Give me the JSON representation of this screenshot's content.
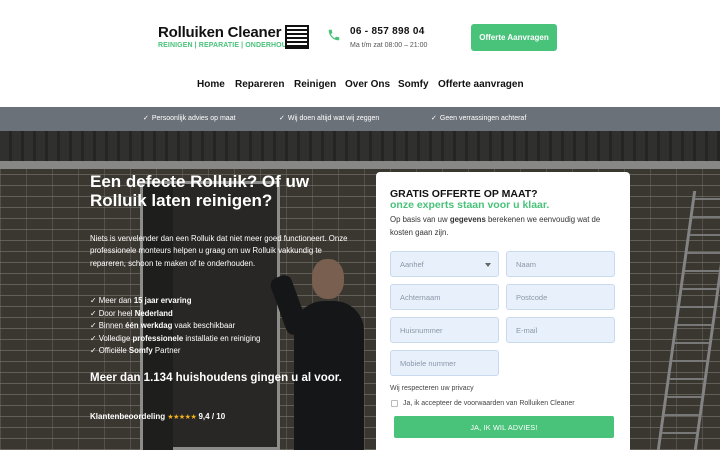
{
  "header": {
    "logo_title": "Rolluiken Cleaner",
    "logo_subtitle": "REINIGEN | REPARATIE | ONDERHOUD",
    "phone_number": "06 - 857 898 04",
    "phone_hours": "Ma t/m zat 08:00 – 21:00",
    "cta_label": "Offerte Aanvragen"
  },
  "nav": {
    "items": [
      "Home",
      "Repareren",
      "Reinigen",
      "Over Ons",
      "Somfy",
      "Offerte aanvragen"
    ]
  },
  "usp": {
    "items": [
      "Persoonlijk advies op maat",
      "Wij doen altijd wat wij zeggen",
      "Geen verrassingen achteraf"
    ]
  },
  "hero": {
    "title": "Een defecte Rolluik? Of uw Rolluik laten reinigen?",
    "intro": "Niets is vervelender dan een Rolluik dat niet meer goed functioneert. Onze professionele monteurs helpen u graag om uw Rolluik vakkundig te repareren, schoon te maken of te onderhouden.",
    "bullets": [
      {
        "pre": "Meer dan ",
        "bold": "15 jaar ervaring",
        "post": ""
      },
      {
        "pre": "Door heel ",
        "bold": "Nederland",
        "post": ""
      },
      {
        "pre": "Binnen ",
        "bold": "één werkdag",
        "post": " vaak beschikbaar"
      },
      {
        "pre": "Volledige ",
        "bold": "professionele",
        "post": " installatie en reiniging"
      },
      {
        "pre": "Officiële ",
        "bold": "Somfy",
        "post": " Partner"
      }
    ],
    "households": "Meer dan 1.134 huishoudens gingen u al voor.",
    "rating_label": "Klantenbeoordeling",
    "rating_stars": "★★★★★",
    "rating_score": "9,4 / 10"
  },
  "form": {
    "title": "GRATIS OFFERTE OP MAAT?",
    "subtitle": "onze experts staan voor u klaar.",
    "intro_pre": "Op basis van uw ",
    "intro_bold": "gegevens",
    "intro_post": " berekenen we eenvoudig wat de kosten gaan zijn.",
    "fields": {
      "aanhef": "Aanhef",
      "naam": "Naam",
      "achternaam": "Achternaam",
      "postcode": "Postcode",
      "huisnummer": "Huisnummer",
      "email": "E-mail",
      "mobiel": "Mobiele nummer"
    },
    "privacy": "Wij respecteren uw privacy",
    "consent": "Ja, ik accepteer de voorwaarden van Rolluiken Cleaner",
    "submit": "JA, IK WIL ADVIES!"
  },
  "colors": {
    "accent": "#49c27a",
    "usp_bar": "#6b7178",
    "star": "#f2b01e"
  }
}
